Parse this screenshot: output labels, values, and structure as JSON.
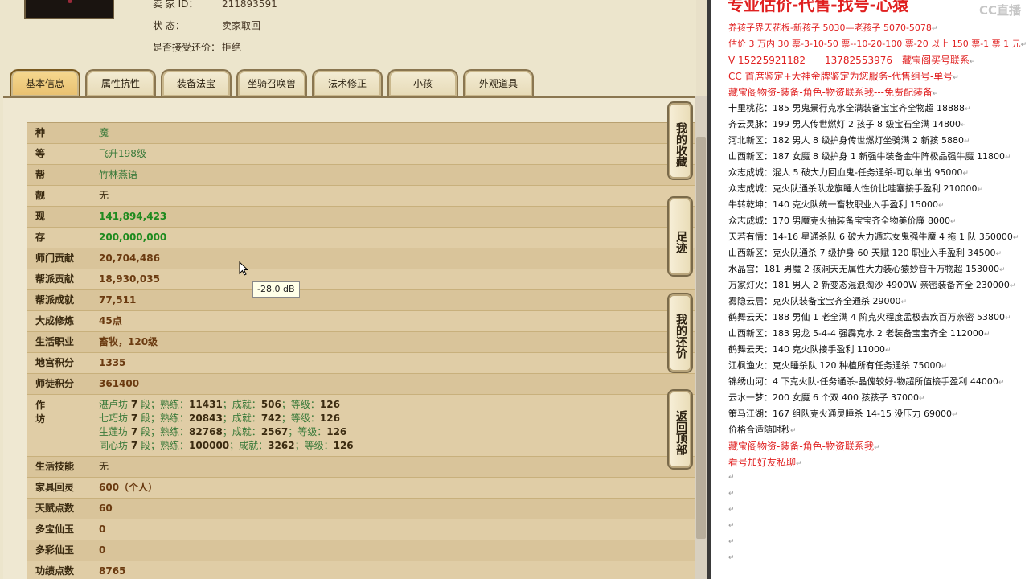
{
  "seller": {
    "id_label": "卖 家 ID：",
    "id_value": "211893591",
    "status_label": "状 态：",
    "status_value": "卖家取回",
    "counter_label": "是否接受还价：",
    "counter_value": "拒绝"
  },
  "tabs": [
    "基本信息",
    "属性抗性",
    "装备法宝",
    "坐骑召唤兽",
    "法术修正",
    "小孩",
    "外观道具"
  ],
  "rows": [
    {
      "label": "种 族",
      "value": "魔"
    },
    {
      "label": "等 级",
      "value": "飞升198级"
    },
    {
      "label": "帮 派",
      "value": "竹林燕语"
    },
    {
      "label": "靓 号",
      "value": "无"
    },
    {
      "label": "现 金",
      "value": "141,894,423"
    },
    {
      "label": "存 款",
      "value": "200,000,000"
    },
    {
      "label": "师门贡献",
      "value": "20,704,486"
    },
    {
      "label": "帮派贡献",
      "value": "18,930,035"
    },
    {
      "label": "帮派成就",
      "value": "77,511"
    },
    {
      "label": "大成修炼",
      "value": "45点"
    },
    {
      "label": "生活职业",
      "value": "畜牧，120级"
    },
    {
      "label": "地宫积分",
      "value": "1335"
    },
    {
      "label": "师徒积分",
      "value": "361400"
    },
    {
      "label": "作 坊",
      "value": ""
    },
    {
      "label": "生活技能",
      "value": "无"
    },
    {
      "label": "家具回灵",
      "value": "600（个人）"
    },
    {
      "label": "天赋点数",
      "value": "60"
    },
    {
      "label": "多宝仙玉",
      "value": "0"
    },
    {
      "label": "多彩仙玉",
      "value": "0"
    },
    {
      "label": "功绩点数",
      "value": "8765"
    }
  ],
  "workshops": [
    {
      "name": "湛卢坊",
      "level": "7",
      "skill": "11431",
      "achieve": "506",
      "grade": "126"
    },
    {
      "name": "七巧坊",
      "level": "7",
      "skill": "20843",
      "achieve": "742",
      "grade": "126"
    },
    {
      "name": "生莲坊",
      "level": "7",
      "skill": "82768",
      "achieve": "2567",
      "grade": "126"
    },
    {
      "name": "同心坊",
      "level": "7",
      "skill": "100000",
      "achieve": "3262",
      "grade": "126"
    }
  ],
  "workshop_text": {
    "seg": "段；熟练：",
    "achieve": "；成就：",
    "grade": "；等级："
  },
  "side_buttons": [
    "我的收藏",
    "足迹",
    "我的还价",
    "返回顶部"
  ],
  "tooltip": "-28.0 dB",
  "notes": {
    "watermark": "CC直播",
    "headline": "专业估价-代售-找号-心猿",
    "lines": [
      {
        "text": "养孩子界天花板-新孩子 5030—老孩子 5070-5078",
        "red": true
      },
      {
        "text": "估价 3 万内 30 票-3-10-50 票--10-20-100 票-20 以上 150 票-1 票 1 元",
        "red": true
      },
      {
        "text": "V 15225921182　　13782553976　藏宝阁买号联系",
        "red": true,
        "big": true
      },
      {
        "text": "CC 首席鉴定+大神金牌鉴定为您服务-代售组号-单号",
        "red": true,
        "big": true
      },
      {
        "text": "藏宝阁物资-装备-角色-物资联系我---免费配装备",
        "red": true,
        "big": true
      },
      {
        "text": "十里桃花：185 男鬼景行克水全满装备宝宝齐全物超 18888"
      },
      {
        "text": "齐云灵脉：199 男人传世燃灯 2 孩子 8 级宝石全满 14800"
      },
      {
        "text": "河北新区：182 男人 8 级护身传世燃灯坐骑满 2 新孩 5880"
      },
      {
        "text": "山西新区：187 女魔 8 级护身 1 新强牛装备金牛阵极品强牛魔 11800"
      },
      {
        "text": "众志成城：混人 5 破大力回血鬼-任务通杀-可以单出 95000"
      },
      {
        "text": "众志成城：克火队通杀队龙旗睡人性价比哇塞接手盈利 210000"
      },
      {
        "text": "牛转乾坤：140 克火队统一畜牧职业入手盈利 15000"
      },
      {
        "text": "众志成城：170 男魔克火抽装备宝宝齐全物美价廉 8000"
      },
      {
        "text": "天若有情：14-16 星通杀队 6 破大力遁忘女鬼强牛魔 4 拖 1 队 350000"
      },
      {
        "text": "山西新区：克火队通杀 7 级护身 60 天赋 120 职业入手盈利 34500"
      },
      {
        "text": "水晶宫：181 男魔 2 孩洞天无属性大力装心猿妙音千万物超 153000"
      },
      {
        "text": "万家灯火：181 男人 2 新变态混浪淘沙 4900W 亲密装备齐全 230000"
      },
      {
        "text": "雾隐云居：克火队装备宝宝齐全通杀 29000"
      },
      {
        "text": "鹤舞云天：188 男仙 1 老全满 4 阶克火程度孟极去疾百万亲密 53800"
      },
      {
        "text": "山西新区：183 男龙 5-4-4 强霹克水 2 老装备宝宝齐全 112000"
      },
      {
        "text": "鹤舞云天：140 克火队接手盈利 11000"
      },
      {
        "text": "江枫渔火：克火睡杀队 120 种植所有任务通杀 75000"
      },
      {
        "text": "锦绣山河：4 下克火队-任务通杀-晶傀较好-物超所值接手盈利 44000"
      },
      {
        "text": "云水一梦：200 女魔 6 个双 400 孩孩子 37000"
      },
      {
        "text": "策马江湖：167 组队克火通灵睡杀 14-15 没压力 69000"
      },
      {
        "text": "价格合适随时秒"
      },
      {
        "text": "藏宝阁物资-装备-角色-物资联系我",
        "red": true,
        "big": true
      },
      {
        "text": "看号加好友私聊",
        "red": true,
        "big": true
      }
    ],
    "para_mark": "↵"
  },
  "colors": {
    "note_red": "#e02020",
    "tab_active": "#f0c878",
    "table_bg": "#d9c49a",
    "value_green": "#3a7a3a"
  }
}
